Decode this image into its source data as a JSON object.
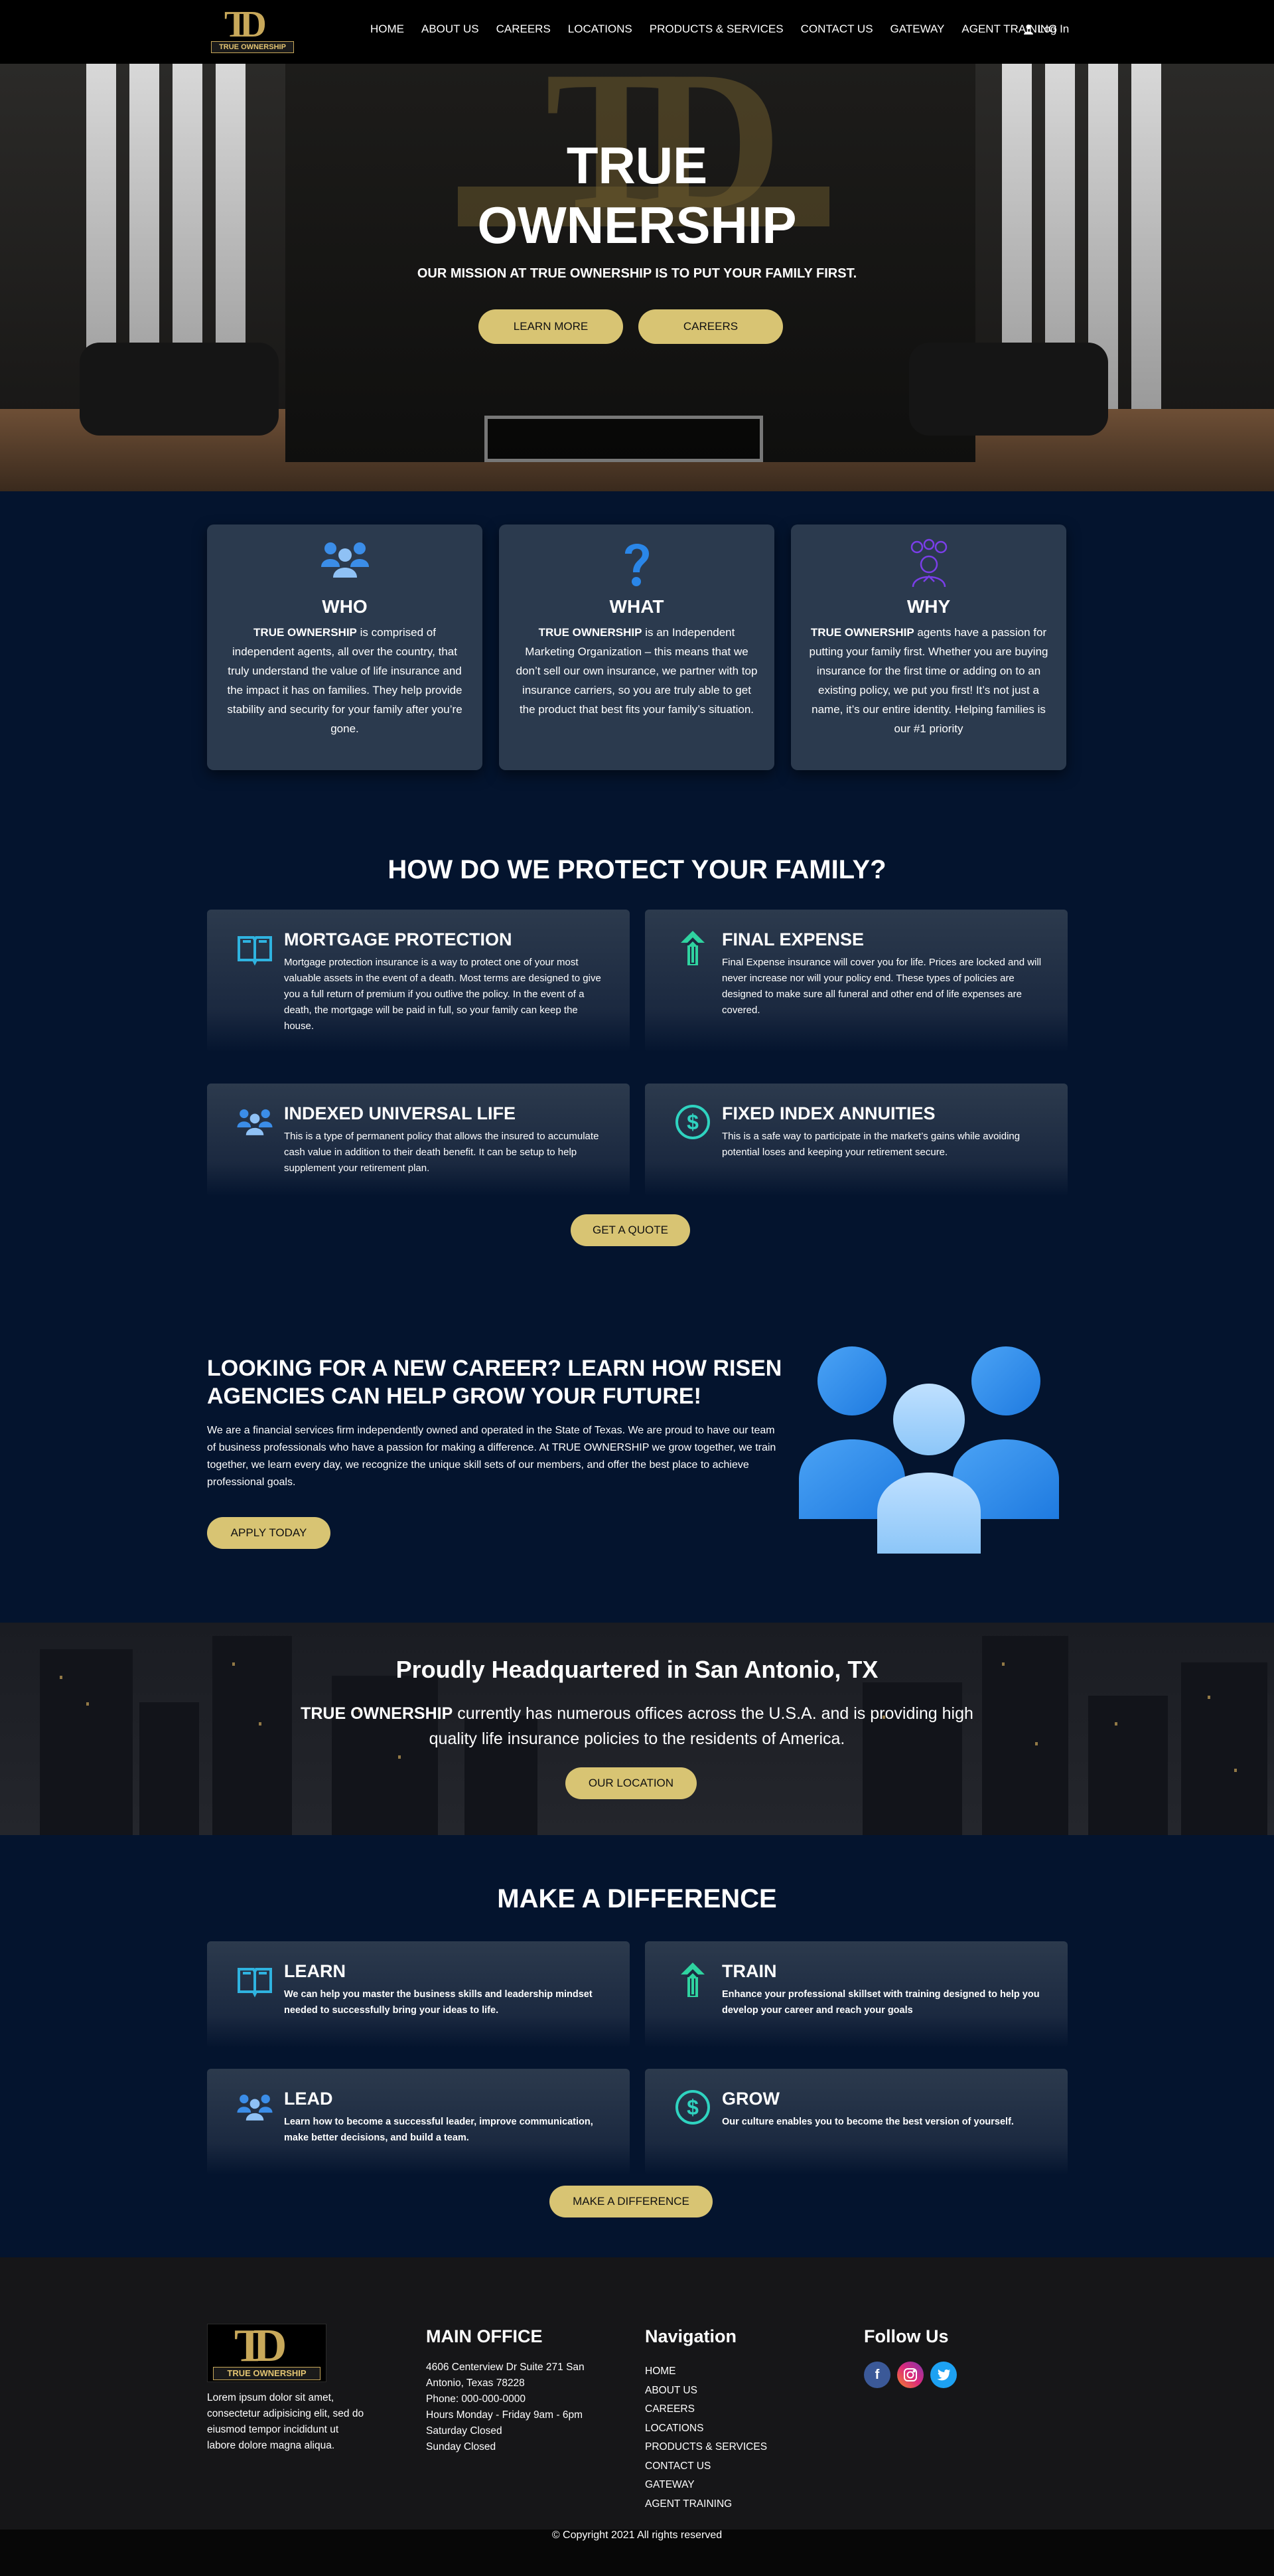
{
  "nav": {
    "logo_text": "TRUE OWNERSHIP",
    "items": [
      "HOME",
      "ABOUT US",
      "CAREERS",
      "LOCATIONS",
      "PRODUCTS & SERVICES",
      "CONTACT US",
      "GATEWAY",
      "AGENT TRAINING"
    ],
    "login": "Log In"
  },
  "hero": {
    "title_line1": "TRUE",
    "title_line2": "OWNERSHIP",
    "subtitle": "OUR MISSION AT TRUE OWNERSHIP IS TO PUT YOUR FAMILY FIRST.",
    "btn_learn": "LEARN MORE",
    "btn_careers": "CAREERS"
  },
  "intro": [
    {
      "icon": "users-icon",
      "title": "WHO",
      "lead": "TRUE OWNERSHIP",
      "text": " is comprised of independent agents, all over the country, that truly understand the value of life insurance and the impact it has on families. They help provide stability and security for your family after you’re gone."
    },
    {
      "icon": "question-icon",
      "title": "WHAT",
      "lead": "TRUE OWNERSHIP",
      "text": " is an Independent Marketing Organization – this means that we don’t sell our own insurance, we partner with top insurance carriers, so you are truly able to get the product that best fits your family’s situation."
    },
    {
      "icon": "thinking-person-icon",
      "title": "WHY",
      "lead": "TRUE OWNERSHIP",
      "text": " agents have a passion for putting your family first. Whether you are buying insurance for the first time or adding on to an existing policy, we put you first! It’s not just a name, it’s our entire identity. Helping families is our #1 priority"
    }
  ],
  "protect": {
    "title": "HOW DO WE PROTECT YOUR FAMILY?",
    "cards": [
      {
        "title": "MORTGAGE PROTECTION",
        "text": "Mortgage protection insurance is a way to protect one of your most valuable assets in the event of a death. Most terms are designed to give you a full return of premium if you outlive the policy. In the event of a death, the mortgage will be paid in full, so your family can keep the house."
      },
      {
        "title": "FINAL EXPENSE",
        "text": "Final Expense insurance will cover you for life. Prices are locked and will never increase nor will your policy end. These types of policies are designed to make sure all funeral and other end of life expenses are covered."
      },
      {
        "title": "INDEXED UNIVERSAL LIFE",
        "text": "This is a type of permanent policy that allows the insured to accumulate cash value in addition to their death benefit. It can be setup to help supplement your retirement plan."
      },
      {
        "title": "FIXED INDEX ANNUITIES",
        "text": "This is a safe way to participate in the market’s gains while avoiding potential loses and keeping your retirement secure."
      }
    ],
    "btn": "GET A QUOTE"
  },
  "career": {
    "title": "LOOKING FOR A NEW CAREER? LEARN HOW RISEN AGENCIES CAN HELP GROW YOUR FUTURE!",
    "text": "We are a financial services firm independently owned and operated in the State of Texas. We are proud to have our team of business professionals who have a passion for making a difference. At TRUE OWNERSHIP we grow together, we train together, we learn every day, we recognize the unique skill sets of our members, and offer the best place to achieve professional goals.",
    "btn": "APPLY TODAY"
  },
  "hq": {
    "title": "Proudly Headquartered in San Antonio, TX",
    "lead": "TRUE OWNERSHIP",
    "text": " currently has numerous offices across the U.S.A. and is providing high quality life insurance policies to the residents of America.",
    "btn": "OUR LOCATION"
  },
  "difference": {
    "title": "MAKE A DIFFERENCE",
    "cards": [
      {
        "title": "LEARN",
        "text": "We can help you master the business skills and leadership mindset needed to successfully bring your ideas to life."
      },
      {
        "title": "TRAIN",
        "text": "Enhance your professional skillset with training designed to help you develop your career and reach your goals"
      },
      {
        "title": "LEAD",
        "text": "Learn how to become a successful leader, improve communication, make better decisions, and build a team."
      },
      {
        "title": "GROW",
        "text": "Our culture enables you to become the best version of yourself."
      }
    ],
    "btn": "MAKE A DIFFERENCE"
  },
  "footer": {
    "about": "Lorem ipsum dolor sit amet, consectetur adipisicing elit, sed do eiusmod tempor incididunt ut labore dolore magna aliqua.",
    "office_title": "MAIN OFFICE",
    "office_lines": [
      "4606 Centerview Dr Suite 271 San",
      "Antonio, Texas 78228",
      "Phone: 000-000-0000",
      "Hours Monday - Friday 9am - 6pm",
      "Saturday Closed",
      "Sunday Closed"
    ],
    "nav_title": "Navigation",
    "nav_items": [
      "HOME",
      "ABOUT US",
      "CAREERS",
      "LOCATIONS",
      "PRODUCTS & SERVICES",
      "CONTACT US",
      "GATEWAY",
      "AGENT TRAINING"
    ],
    "follow_title": "Follow Us",
    "social": [
      "facebook-icon",
      "instagram-icon",
      "twitter-icon"
    ],
    "copyright": "© Copyright 2021 All rights reserved"
  },
  "colors": {
    "accent": "#d8c473",
    "bg": "#04142e",
    "card": "#2b3a4e",
    "blue": "#3b8de8",
    "green": "#2fd3a0"
  }
}
